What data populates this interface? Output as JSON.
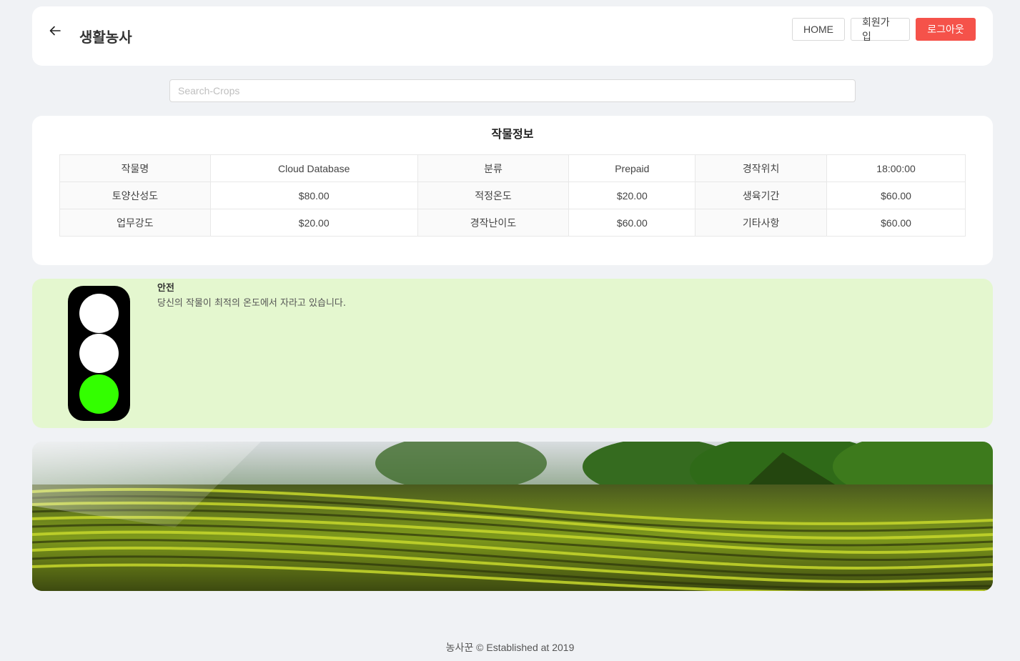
{
  "header": {
    "title": "생활농사",
    "nav": {
      "home": "HOME",
      "signup": "회원가입",
      "logout": "로그아웃"
    }
  },
  "search": {
    "placeholder": "Search-Crops",
    "value": ""
  },
  "crop_info": {
    "title": "작물정보",
    "rows": [
      [
        {
          "label": "작물명",
          "value": "Cloud Database"
        },
        {
          "label": "분류",
          "value": "Prepaid"
        },
        {
          "label": "경작위치",
          "value": "18:00:00"
        }
      ],
      [
        {
          "label": "토양산성도",
          "value": "$80.00"
        },
        {
          "label": "적정온도",
          "value": "$20.00"
        },
        {
          "label": "생육기간",
          "value": "$60.00"
        }
      ],
      [
        {
          "label": "업무강도",
          "value": "$20.00"
        },
        {
          "label": "경작난이도",
          "value": "$60.00"
        },
        {
          "label": "기타사항",
          "value": "$60.00"
        }
      ]
    ]
  },
  "status": {
    "title": "안전",
    "message": "당신의 작물이 최적의 온도에서 자라고 있습니다.",
    "active_light": "green",
    "colors": {
      "background": "#e4f7cf",
      "green": "#33ff00",
      "off": "#ffffff",
      "housing": "#000000"
    }
  },
  "accent_color": "#f5524a",
  "footer": {
    "text": "농사꾼 © Established at 2019"
  }
}
